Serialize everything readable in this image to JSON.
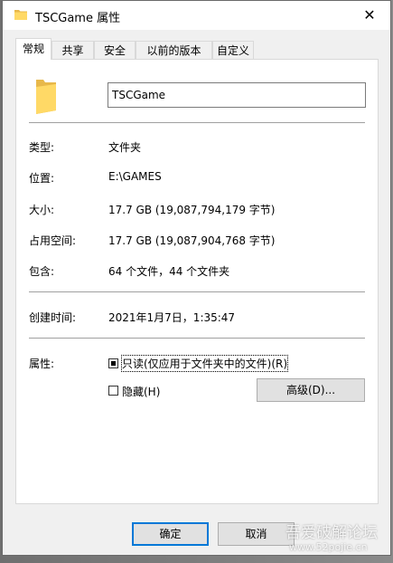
{
  "window": {
    "title": "TSCGame 属性",
    "close_symbol": "✕"
  },
  "tabs": [
    {
      "label": "常规",
      "active": true
    },
    {
      "label": "共享",
      "active": false
    },
    {
      "label": "安全",
      "active": false
    },
    {
      "label": "以前的版本",
      "active": false
    },
    {
      "label": "自定义",
      "active": false
    }
  ],
  "general": {
    "folder_icon": "folder-icon",
    "name_value": "TSCGame",
    "type_label": "类型:",
    "type_value": "文件夹",
    "location_label": "位置:",
    "location_value": "E:\\GAMES",
    "size_label": "大小:",
    "size_value": "17.7 GB (19,087,794,179 字节)",
    "size_on_disk_label": "占用空间:",
    "size_on_disk_value": "17.7 GB (19,087,904,768 字节)",
    "contains_label": "包含:",
    "contains_value": "64 个文件，44 个文件夹",
    "created_label": "创建时间:",
    "created_value": "2021年1月7日，1:35:47",
    "attributes_label": "属性:",
    "readonly_label": "只读(仅应用于文件夹中的文件)(R)",
    "readonly_state": "indeterminate",
    "hidden_label": "隐藏(H)",
    "hidden_state": "unchecked",
    "advanced_label": "高级(D)..."
  },
  "footer": {
    "ok_label": "确定",
    "cancel_label": "取消"
  },
  "watermark": {
    "text": "吾爱破解论坛",
    "url": "www.52pojie.cn"
  },
  "colors": {
    "accent": "#0078d7",
    "folder": "#ffd966",
    "folder_dark": "#e8b84a"
  }
}
